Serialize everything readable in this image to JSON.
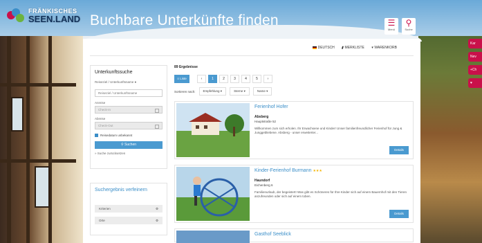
{
  "logo": {
    "line1": "FRÄNKISCHES",
    "line2": "SEEN.LAND"
  },
  "header": {
    "title": "Buchbare Unterkünfte finden",
    "menu_label": "Menü",
    "search_label": "Suche"
  },
  "toplinks": {
    "language": "DEUTSCH",
    "watchlist": "MERKLISTE",
    "cart": "WARENKORB"
  },
  "sidebar": {
    "title": "Unterkunftssuche",
    "keyword_label": "Reiseziel / Unterkunftsname",
    "keyword_placeholder": "Reiseziel / Unterkunftsname",
    "arrival_label": "Anreise",
    "arrival_placeholder": "Check-In",
    "departure_label": "Abreise",
    "departure_placeholder": "Check-Out",
    "date_unknown": "Reisedatum unbekannt",
    "search_button": "Suchen",
    "reset_link": "» Suche zurücksetzen"
  },
  "refine": {
    "title": "Suchergebnis verfeinern",
    "facets": [
      "Kriterien",
      "Orte"
    ]
  },
  "results": {
    "count_text": "89 Ergebnisse",
    "list_button": "Liste",
    "pages": [
      "‹",
      "1",
      "2",
      "3",
      "4",
      "5",
      "›"
    ],
    "active_page": "1",
    "sort_label": "Sortieren nach:",
    "sort_options": [
      "Empfehlung ▾",
      "Sterne ▾",
      "Name ▾"
    ]
  },
  "listings": [
    {
      "title": "Ferienhof Hofer",
      "location": "Absberg",
      "address": "Hauptstraße 52",
      "description": "Willkommen zum sich erholen. Ihr Erwachsene und Kinder! Unser familienfreundlicher Ferienhof für Jung & Junggebliebene. Absberg - unser erweiterter...",
      "stars": "",
      "details": "Details"
    },
    {
      "title": "Kinder-Ferienhof Burmann",
      "location": "Haundorf",
      "address": "Eichenberg 6",
      "description": "Familienurlaub, der begeistert! Was gibt es Schöneres für Ihre Kinder sich auf einem Bauernhof mit den Tieren anzufreunden oder sich auf einem toben.",
      "stars": "★★★",
      "details": "Details"
    },
    {
      "title": "Gasthof Seeblick"
    }
  ],
  "sidetabs": [
    "Kar",
    "Nev",
    "+Ch",
    "♥"
  ],
  "colors": {
    "accent": "#4a9ad0",
    "brand": "#c9104a",
    "title": "#3a8ec8"
  }
}
